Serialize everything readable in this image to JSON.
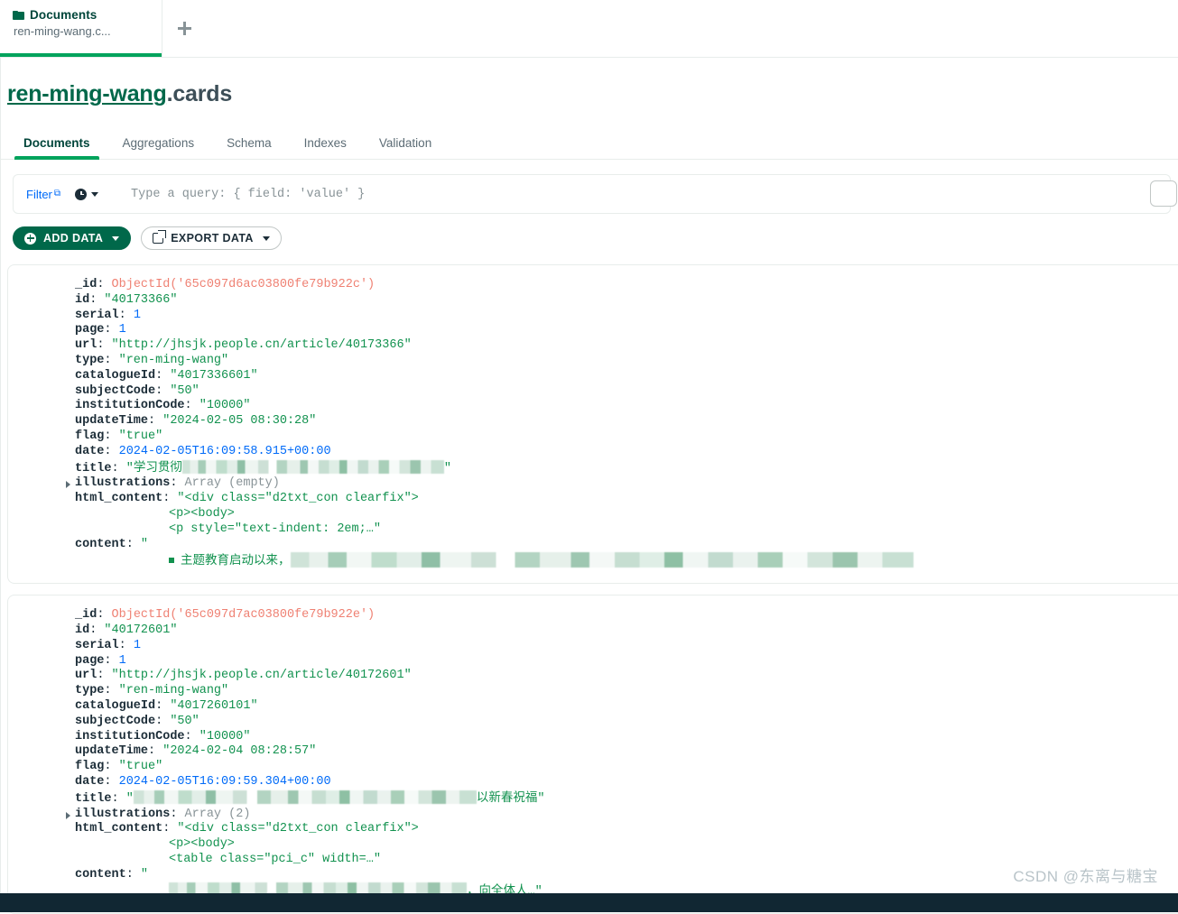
{
  "window": {
    "tab": {
      "icon": "folder-icon",
      "title": "Documents",
      "subtitle": "ren-ming-wang.c...",
      "new_tab_icon": "plus-icon"
    }
  },
  "namespace": {
    "database": "ren-ming-wang",
    "separator": ".",
    "collection": "cards"
  },
  "collection_tabs": [
    {
      "label": "Documents",
      "active": true
    },
    {
      "label": "Aggregations",
      "active": false
    },
    {
      "label": "Schema",
      "active": false
    },
    {
      "label": "Indexes",
      "active": false
    },
    {
      "label": "Validation",
      "active": false
    }
  ],
  "query_bar": {
    "filter_label": "Filter",
    "external_link_icon": "external-link-icon",
    "history_icon": "clock-icon",
    "history_caret": "chevron-down-icon",
    "placeholder": "Type a query: { field: 'value' }",
    "value": ""
  },
  "toolbar": {
    "add_data_label": "ADD DATA",
    "export_data_label": "EXPORT DATA"
  },
  "colors": {
    "brand_green": "#00684a",
    "accent_green": "#00a35c",
    "string_green": "#12924f",
    "number_blue": "#016bf8",
    "objectid_red": "#ef8173",
    "link_blue": "#016bf8",
    "footer_dark": "#112733"
  },
  "documents": [
    {
      "fields": [
        {
          "key": "_id",
          "value": "ObjectId('65c097d6ac03800fe79b922c')",
          "type": "objectid"
        },
        {
          "key": "id",
          "value": "\"40173366\"",
          "type": "string"
        },
        {
          "key": "serial",
          "value": "1",
          "type": "number"
        },
        {
          "key": "page",
          "value": "1",
          "type": "number"
        },
        {
          "key": "url",
          "value": "\"http://jhsjk.people.cn/article/40173366\"",
          "type": "string"
        },
        {
          "key": "type",
          "value": "\"ren-ming-wang\"",
          "type": "string"
        },
        {
          "key": "catalogueId",
          "value": "\"4017336601\"",
          "type": "string"
        },
        {
          "key": "subjectCode",
          "value": "\"50\"",
          "type": "string"
        },
        {
          "key": "institutionCode",
          "value": "\"10000\"",
          "type": "string"
        },
        {
          "key": "updateTime",
          "value": "\"2024-02-05 08:30:28\"",
          "type": "string"
        },
        {
          "key": "flag",
          "value": "\"true\"",
          "type": "string"
        },
        {
          "key": "date",
          "value": "2024-02-05T16:09:58.915+00:00",
          "type": "date"
        },
        {
          "key": "title",
          "value": "\"学习贯彻",
          "type": "redacted-string",
          "redacted_width": 290,
          "suffix": "\""
        },
        {
          "key": "illustrations",
          "value": "Array (empty)",
          "type": "meta",
          "expandable": true
        },
        {
          "key": "html_content",
          "value": "\"<div class=\"d2txt_con clearfix\">",
          "type": "string"
        },
        {
          "key": "",
          "value": "<p><body>",
          "type": "string",
          "continuation": true
        },
        {
          "key": "",
          "value": "<p style=\"text-indent: 2em;…\"",
          "type": "string",
          "continuation": true
        },
        {
          "key": "content",
          "value": "\"",
          "type": "string"
        },
        {
          "key": "",
          "value": "主题教育启动以来，",
          "type": "redacted-content",
          "bullet": true,
          "redacted_width": 690
        }
      ]
    },
    {
      "fields": [
        {
          "key": "_id",
          "value": "ObjectId('65c097d7ac03800fe79b922e')",
          "type": "objectid"
        },
        {
          "key": "id",
          "value": "\"40172601\"",
          "type": "string"
        },
        {
          "key": "serial",
          "value": "1",
          "type": "number"
        },
        {
          "key": "page",
          "value": "1",
          "type": "number"
        },
        {
          "key": "url",
          "value": "\"http://jhsjk.people.cn/article/40172601\"",
          "type": "string"
        },
        {
          "key": "type",
          "value": "\"ren-ming-wang\"",
          "type": "string"
        },
        {
          "key": "catalogueId",
          "value": "\"4017260101\"",
          "type": "string"
        },
        {
          "key": "subjectCode",
          "value": "\"50\"",
          "type": "string"
        },
        {
          "key": "institutionCode",
          "value": "\"10000\"",
          "type": "string"
        },
        {
          "key": "updateTime",
          "value": "\"2024-02-04 08:28:57\"",
          "type": "string"
        },
        {
          "key": "flag",
          "value": "\"true\"",
          "type": "string"
        },
        {
          "key": "date",
          "value": "2024-02-05T16:09:59.304+00:00",
          "type": "date"
        },
        {
          "key": "title",
          "value": "\"",
          "type": "redacted-string-end",
          "redacted_width": 380,
          "tail": "以新春祝福\""
        },
        {
          "key": "illustrations",
          "value": "Array (2)",
          "type": "meta",
          "expandable": true
        },
        {
          "key": "html_content",
          "value": "\"<div class=\"d2txt_con clearfix\">",
          "type": "string"
        },
        {
          "key": "",
          "value": "<p><body>",
          "type": "string",
          "continuation": true
        },
        {
          "key": "",
          "value": "<table class=\"pci_c\" width=…\"",
          "type": "string",
          "continuation": true
        },
        {
          "key": "content",
          "value": "\"",
          "type": "string"
        },
        {
          "key": "",
          "value": "",
          "type": "redacted-content-mixed",
          "redacted_width": 330,
          "tail": "，向全体人…\""
        }
      ]
    }
  ],
  "watermark": "CSDN @东离与糖宝"
}
